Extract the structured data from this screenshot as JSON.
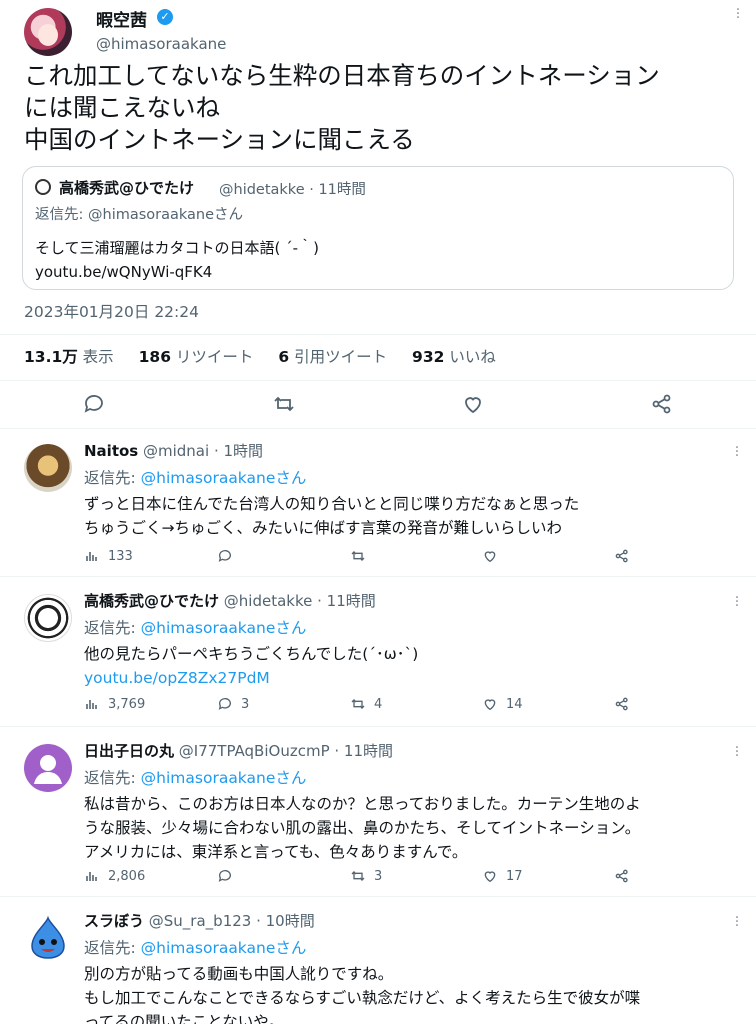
{
  "main_tweet": {
    "display_name": "暇空茜",
    "handle": "@himasoraakane",
    "text_lines": [
      "これ加工してないなら生粋の日本育ちのイントネーション",
      "には聞こえないね",
      "中国のイントネーションに聞こえる"
    ],
    "quote": {
      "display_name": "高橋秀武@ひでたけ",
      "meta": "@hidetakke · 11時間",
      "reply_prefix": "返信先: ",
      "reply_handle": "@himasoraakaneさん",
      "text": "そして三浦瑠麗はカタコトの日本語( ´-｀)",
      "link": "youtu.be/wQNyWi-qFK4"
    },
    "timestamp": "2023年01月20日 22:24",
    "stats": {
      "views_num": "13.1万",
      "views_label": " 表示",
      "retweets_num": "186",
      "retweets_label": " リツイート",
      "quotes_num": "6",
      "quotes_label": " 引用ツイート",
      "likes_num": "932",
      "likes_label": " いいね"
    }
  },
  "replies": [
    {
      "display_name": "Naitos",
      "meta": " @midnai · 1時間",
      "reply_prefix": "返信先: ",
      "reply_handle": "@himasoraakaneさん",
      "lines": [
        "ずっと日本に住んでた台湾人の知り合いとと同じ喋り方だなぁと思った",
        "ちゅうごく→ちゅごく、みたいに伸ばす言葉の発音が難しいらしいわ"
      ],
      "views": "133",
      "replies": "",
      "retweets": "",
      "likes": ""
    },
    {
      "display_name": "高橋秀武@ひでたけ",
      "meta": " @hidetakke · 11時間",
      "reply_prefix": "返信先: ",
      "reply_handle": "@himasoraakaneさん",
      "lines": [
        "他の見たらパーペキちうごくちんでした(´･ω･`)"
      ],
      "link": "youtu.be/opZ8Zx27PdM",
      "views": "3,769",
      "replies": "3",
      "retweets": "4",
      "likes": "14"
    },
    {
      "display_name": "日出子日の丸",
      "meta": " @I77TPAqBiOuzcmP · 11時間",
      "reply_prefix": "返信先: ",
      "reply_handle": "@himasoraakaneさん",
      "lines": [
        "私は昔から、このお方は日本人なのか？と思っておりました。カーテン生地のよ",
        "うな服装、少々場に合わない肌の露出、鼻のかたち、そしてイントネーション。",
        "アメリカには、東洋系と言っても、色々ありますんで。"
      ],
      "views": "2,806",
      "replies": "",
      "retweets": "3",
      "likes": "17"
    },
    {
      "display_name": "スラぼう",
      "meta": " @Su_ra_b123 · 10時間",
      "reply_prefix": "返信先: ",
      "reply_handle": "@himasoraakaneさん",
      "lines": [
        "別の方が貼ってる動画も中国人訛りですね。",
        "もし加工でこんなことできるならすごい執念だけど、よく考えたら生で彼女が喋",
        "ってるの聞いたことないや。"
      ]
    }
  ],
  "colors": {
    "accent": "#1d9bf0",
    "muted": "#536471",
    "text": "#0f1419",
    "border": "#cfd9de"
  },
  "icons": [
    "verified-icon",
    "reply-icon",
    "retweet-icon",
    "like-icon",
    "share-icon",
    "views-icon",
    "more-icon"
  ]
}
